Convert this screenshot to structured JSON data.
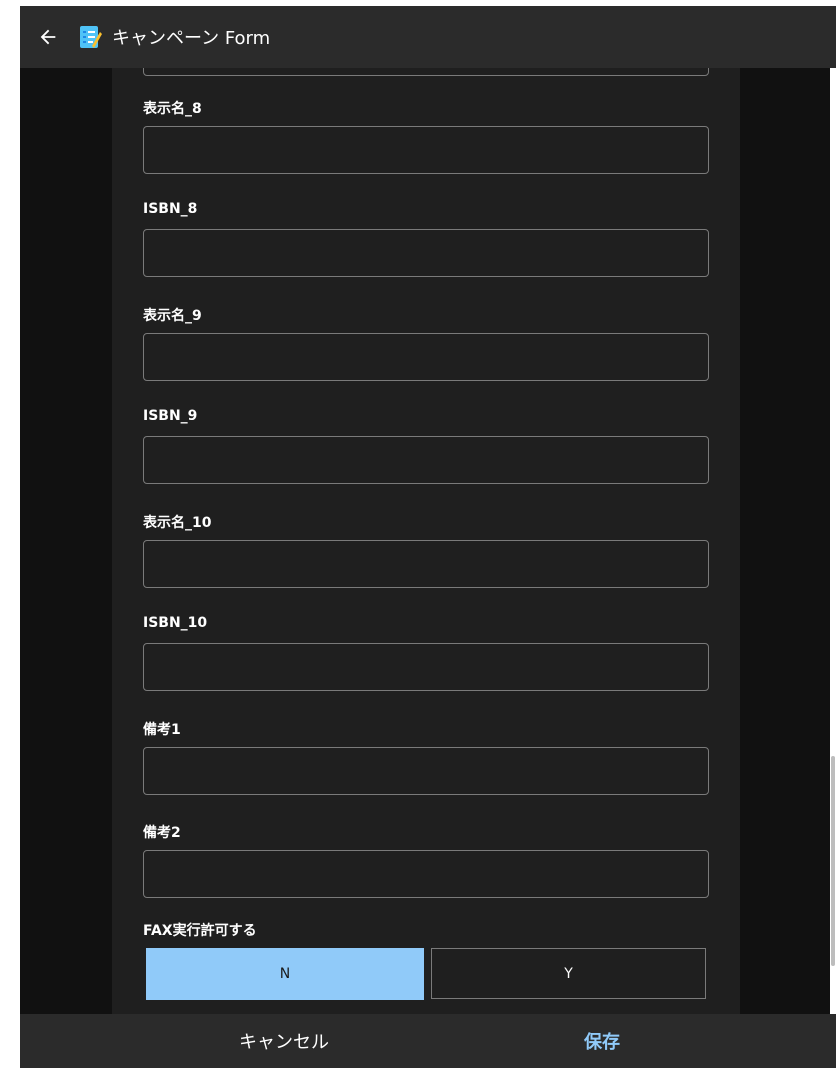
{
  "header": {
    "title": "キャンペーン Form",
    "back_icon": "arrow-left-icon",
    "app_icon": "notepad-icon"
  },
  "form": {
    "fields": [
      {
        "label": "表示名_8",
        "value": ""
      },
      {
        "label": "ISBN_8",
        "value": ""
      },
      {
        "label": "表示名_9",
        "value": ""
      },
      {
        "label": "ISBN_9",
        "value": ""
      },
      {
        "label": "表示名_10",
        "value": ""
      },
      {
        "label": "ISBN_10",
        "value": ""
      },
      {
        "label": "備考1",
        "value": ""
      },
      {
        "label": "備考2",
        "value": ""
      }
    ],
    "fax_toggle": {
      "label": "FAX実行許可する",
      "options": [
        "N",
        "Y"
      ],
      "selected": "N"
    }
  },
  "footer": {
    "cancel_label": "キャンセル",
    "save_label": "保存"
  },
  "colors": {
    "accent": "#90caf9",
    "background": "#1f1f1f",
    "titlebar": "#2b2b2b",
    "field_border": "#7a7a7a"
  }
}
